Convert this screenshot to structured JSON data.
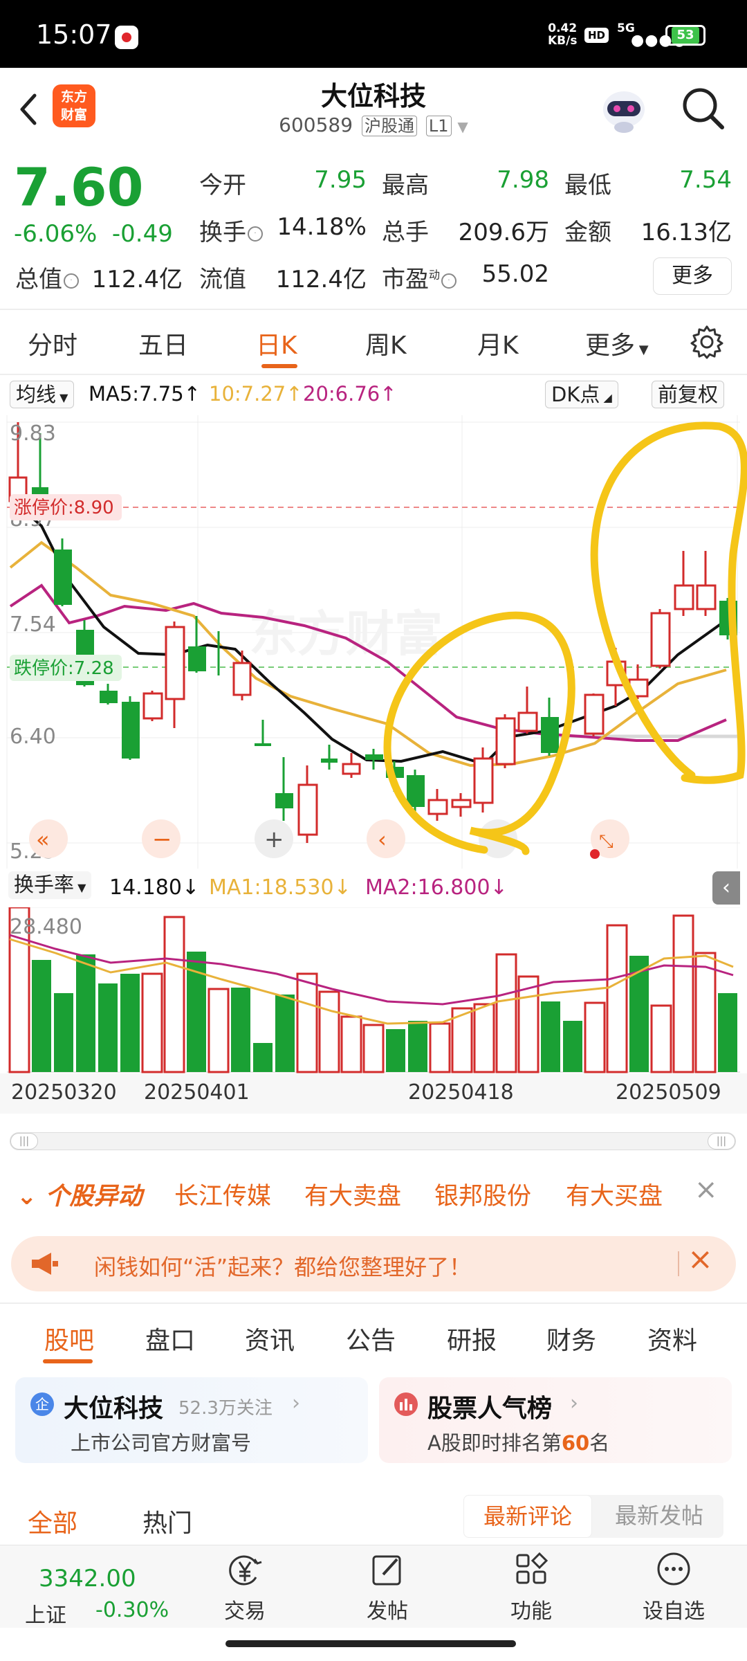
{
  "status_bar": {
    "time": "15:07",
    "net_speed": "0.42\nKB/s",
    "hd": "HD",
    "signal": "5G",
    "battery": "53"
  },
  "header": {
    "logo_text": "东方\n财富",
    "stock_name": "大位科技",
    "stock_code": "600589",
    "market_tag": "沪股通",
    "level_tag": "L1"
  },
  "quote": {
    "price": "7.60",
    "change_pct": "-6.06%",
    "change_amt": "-0.49",
    "open_label": "今开",
    "open": "7.95",
    "high_label": "最高",
    "high": "7.98",
    "low_label": "最低",
    "low": "7.54",
    "turnover_label": "换手",
    "turnover": "14.18%",
    "volume_label": "总手",
    "volume": "209.6万",
    "amount_label": "金额",
    "amount": "16.13亿",
    "mktcap_label": "总值",
    "mktcap": "112.4亿",
    "float_label": "流值",
    "float_cap": "112.4亿",
    "pe_label": "市盈",
    "pe_sup": "动",
    "pe": "55.02",
    "more_button": "更多"
  },
  "chart_tabs": [
    {
      "label": "分时"
    },
    {
      "label": "五日"
    },
    {
      "label": "日K",
      "active": true
    },
    {
      "label": "周K"
    },
    {
      "label": "月K"
    },
    {
      "label": "更多"
    }
  ],
  "ma_bar": {
    "selector": "均线",
    "ma5": "MA5:7.75↑",
    "ma10": "10:7.27↑",
    "ma20": "20:6.76↑",
    "dk_label": "DK点",
    "adjust_label": "前复权"
  },
  "chart_labels": {
    "y_max": "9.83",
    "y_mid": "7.54",
    "y_low": "6.40",
    "y_min": "5.25",
    "y_second": "8.97",
    "limit_up": "涨停价:8.90",
    "limit_down": "跌停价:7.28",
    "watermark": "东方财富"
  },
  "vol_bar": {
    "selector": "换手率",
    "value": "14.180↓",
    "ma1": "MA1:18.530↓",
    "ma2": "MA2:16.800↓",
    "y_max": "28.480"
  },
  "dates": [
    "20250320",
    "20250401",
    "20250418",
    "20250509"
  ],
  "news": {
    "title": "个股异动",
    "items": [
      "长江传媒",
      "有大卖盘",
      "银邦股份",
      "有大买盘"
    ]
  },
  "banner": {
    "text": "闲钱如何“活”起来？都给您整理好了！"
  },
  "sub_tabs": [
    "股吧",
    "盘口",
    "资讯",
    "公告",
    "研报",
    "财务",
    "资料"
  ],
  "cards": {
    "company": {
      "name": "大位科技",
      "followers": "52.3万关注",
      "desc": "上市公司官方财富号",
      "badge": "企"
    },
    "popularity": {
      "name": "股票人气榜",
      "desc_prefix": "A股即时排名第",
      "rank": "60",
      "desc_suffix": "名"
    }
  },
  "filters": {
    "all": "全部",
    "hot": "热门",
    "latest_comment": "最新评论",
    "latest_post": "最新发帖"
  },
  "bottom_nav": {
    "index_value": "3342.00",
    "index_name": "上证",
    "index_change": "-0.30%",
    "items": [
      "交易",
      "发帖",
      "功能",
      "设自选"
    ]
  },
  "colors": {
    "up": "#d22b2b",
    "down": "#1aa034",
    "accent": "#e8641a",
    "ma5": "#111111",
    "ma10": "#e8b23a",
    "ma20": "#b8237f",
    "annotation": "#f5c518"
  }
}
